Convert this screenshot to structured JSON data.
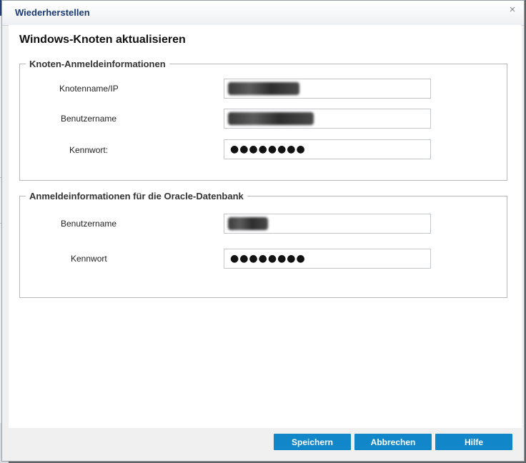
{
  "dialog": {
    "title": "Wiederherstellen",
    "close_glyph": "×",
    "heading": "Windows-Knoten aktualisieren"
  },
  "node_credentials": {
    "legend": "Knoten-Anmeldeinformationen",
    "hostname_label": "Knotenname/IP",
    "username_label": "Benutzername",
    "password_label": "Kennwort:",
    "password_value": "●●●●●●●●"
  },
  "oracle_credentials": {
    "legend": "Anmeldeinformationen für die Oracle-Datenbank",
    "username_label": "Benutzername",
    "password_label": "Kennwort",
    "password_value": "●●●●●●●●"
  },
  "buttons": {
    "save": "Speichern",
    "cancel": "Abbrechen",
    "help": "Hilfe"
  },
  "colors": {
    "title_text": "#1b3a73",
    "button_bg": "#1186c8",
    "button_text": "#ffffff"
  }
}
